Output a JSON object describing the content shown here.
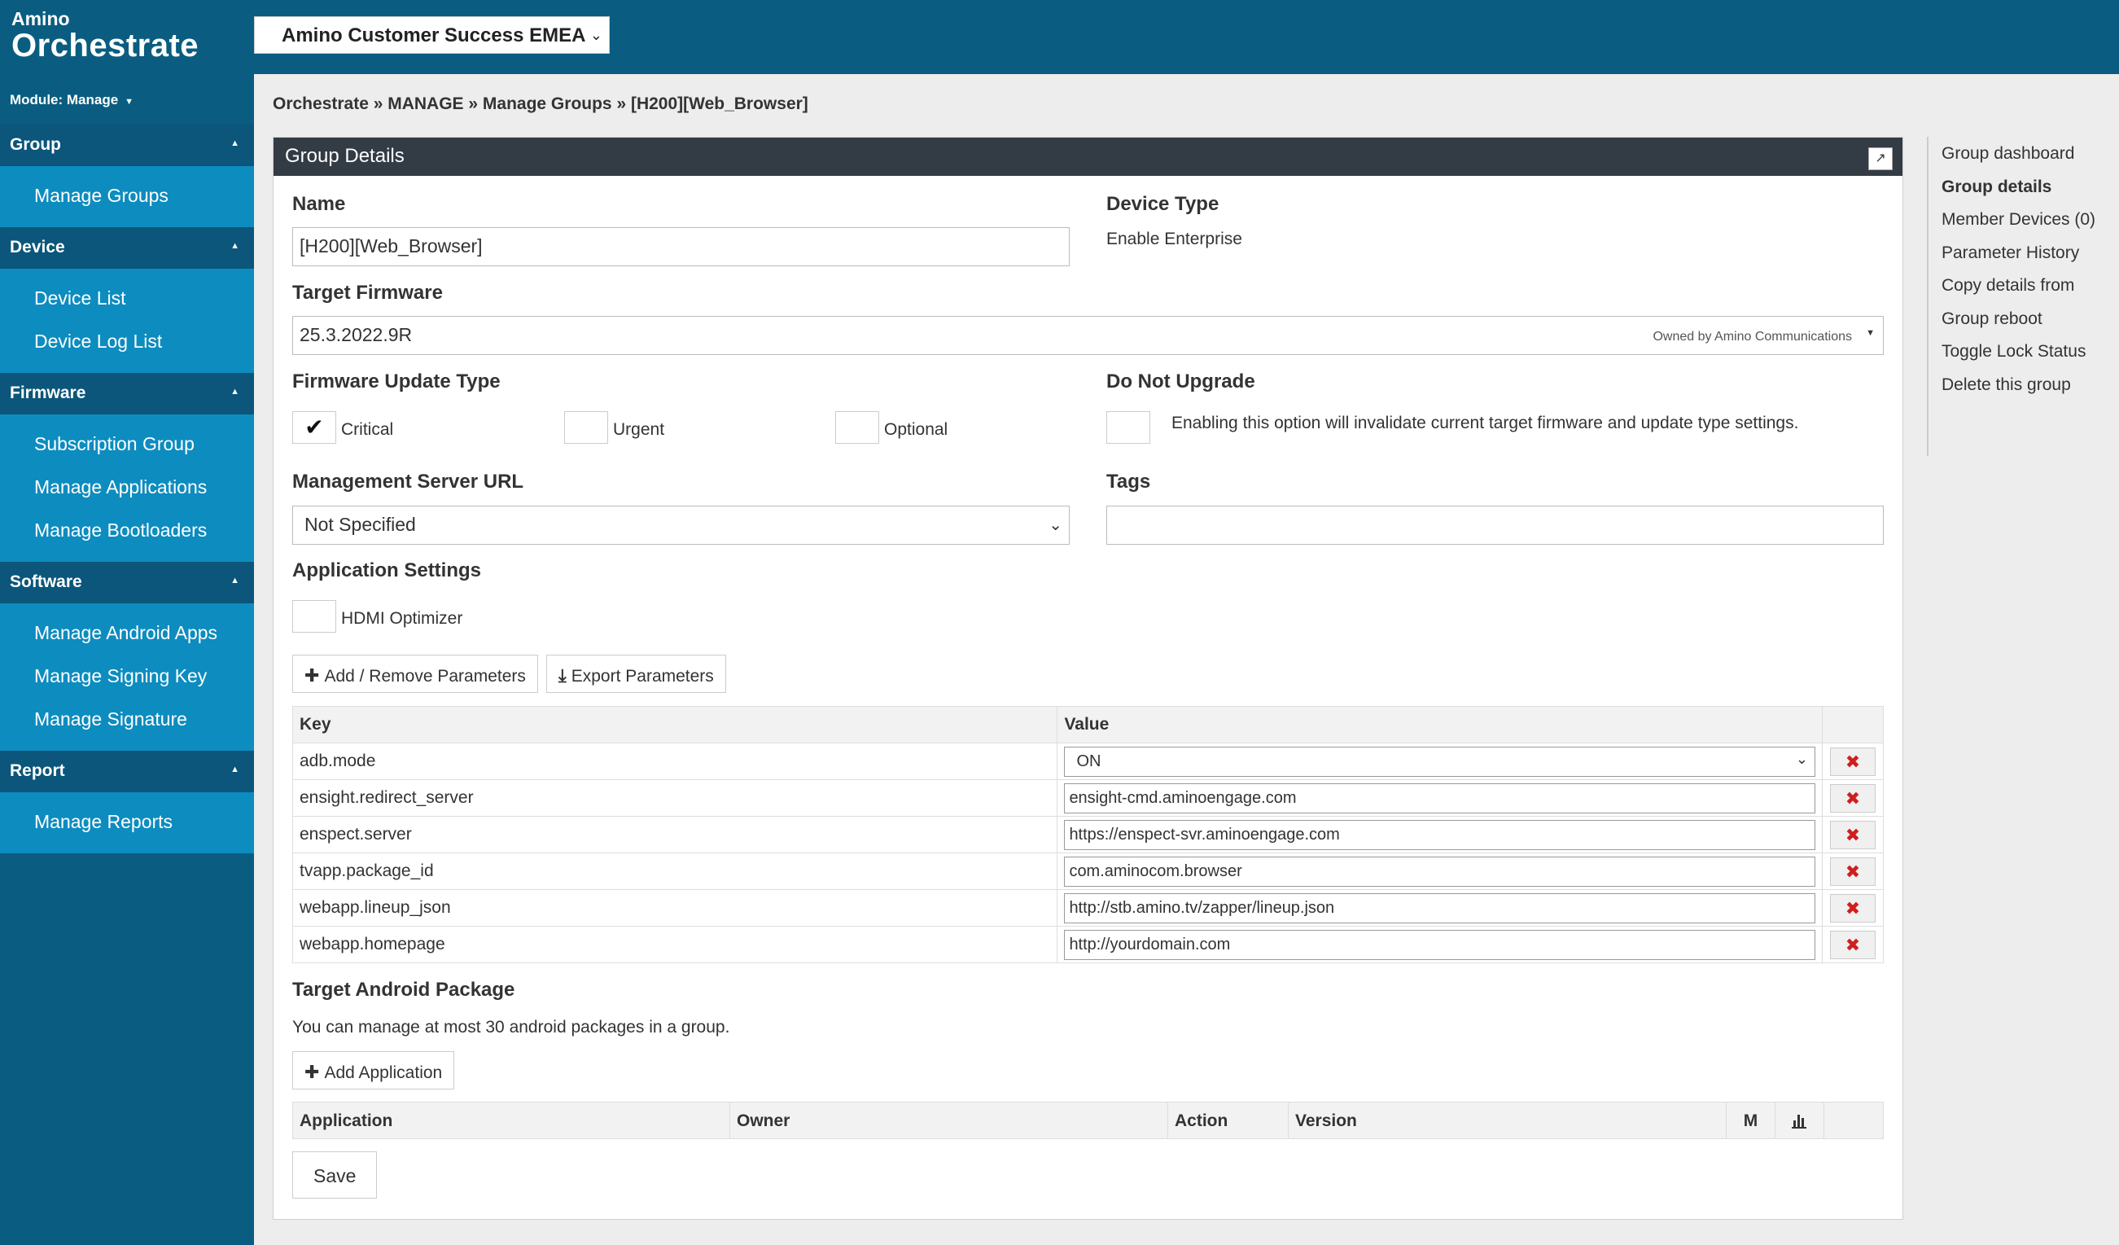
{
  "app": {
    "logo_small": "Amino",
    "logo_big": "Orchestrate",
    "org_selector": "Amino Customer Success EMEA"
  },
  "sidebar": {
    "module_label": "Module: Manage",
    "sections": [
      {
        "title": "Group",
        "items": [
          "Manage Groups"
        ]
      },
      {
        "title": "Device",
        "items": [
          "Device List",
          "Device Log List"
        ]
      },
      {
        "title": "Firmware",
        "items": [
          "Subscription Group",
          "Manage Applications",
          "Manage Bootloaders"
        ]
      },
      {
        "title": "Software",
        "items": [
          "Manage Android Apps",
          "Manage Signing Key",
          "Manage Signature"
        ]
      },
      {
        "title": "Report",
        "items": [
          "Manage Reports"
        ]
      }
    ]
  },
  "breadcrumb": "Orchestrate » MANAGE » Manage Groups » [H200][Web_Browser]",
  "panel": {
    "title": "Group Details",
    "name_label": "Name",
    "name_value": "[H200][Web_Browser]",
    "device_type_label": "Device Type",
    "device_type_value": "Enable Enterprise",
    "target_firmware_label": "Target Firmware",
    "target_firmware_value": "25.3.2022.9R",
    "target_firmware_owner": "Owned by Amino Communications",
    "fw_update_type_label": "Firmware Update Type",
    "fw_update_options": [
      {
        "label": "Critical",
        "checked": true
      },
      {
        "label": "Urgent",
        "checked": false
      },
      {
        "label": "Optional",
        "checked": false
      }
    ],
    "do_not_upgrade_label": "Do Not Upgrade",
    "do_not_upgrade_desc": "Enabling this option will invalidate current target firmware and update type settings.",
    "mgmt_url_label": "Management Server URL",
    "mgmt_url_value": "Not Specified",
    "tags_label": "Tags",
    "tags_value": "",
    "app_settings_label": "Application Settings",
    "hdmi_optimizer_label": "HDMI Optimizer",
    "add_remove_params_btn": "Add / Remove Parameters",
    "export_params_btn": "Export Parameters",
    "params_table": {
      "key_header": "Key",
      "value_header": "Value",
      "rows": [
        {
          "key": "adb.mode",
          "value": "ON",
          "is_select": true
        },
        {
          "key": "ensight.redirect_server",
          "value": "ensight-cmd.aminoengage.com",
          "is_select": false
        },
        {
          "key": "enspect.server",
          "value": "https://enspect-svr.aminoengage.com",
          "is_select": false
        },
        {
          "key": "tvapp.package_id",
          "value": "com.aminocom.browser",
          "is_select": false
        },
        {
          "key": "webapp.lineup_json",
          "value": "http://stb.amino.tv/zapper/lineup.json",
          "is_select": false
        },
        {
          "key": "webapp.homepage",
          "value": "http://yourdomain.com",
          "is_select": false
        }
      ]
    },
    "target_android_label": "Target Android Package",
    "target_android_desc": "You can manage at most 30 android packages in a group.",
    "add_application_btn": "Add Application",
    "apps_table": {
      "application_header": "Application",
      "owner_header": "Owner",
      "action_header": "Action",
      "version_header": "Version",
      "m_header": "M"
    },
    "save_btn": "Save"
  },
  "right_nav": {
    "items": [
      {
        "label": "Group dashboard",
        "active": false
      },
      {
        "label": "Group details",
        "active": true
      },
      {
        "label": "Member Devices (0)",
        "active": false
      },
      {
        "label": "Parameter History",
        "active": false
      },
      {
        "label": "Copy details from",
        "active": false
      },
      {
        "label": "Group reboot",
        "active": false
      },
      {
        "label": "Toggle Lock Status",
        "active": false
      },
      {
        "label": "Delete this group",
        "active": false
      }
    ]
  }
}
